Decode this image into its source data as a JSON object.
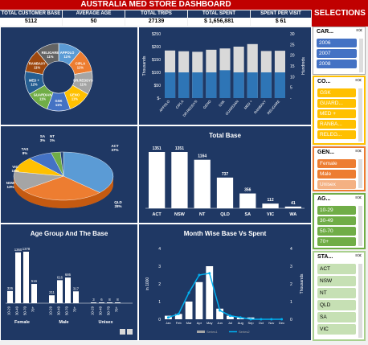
{
  "header": {
    "title": "AUSTRALIA MED STORE DASHBOARD",
    "selections": "SELECTIONS"
  },
  "kpis": [
    {
      "label": "TOTAL CUSTOMER BASE",
      "value": "5112"
    },
    {
      "label": "AVERAGE AGE",
      "value": "50"
    },
    {
      "label": "TOTAL TRIPS",
      "value": "27139"
    },
    {
      "label": "TOTAL SPENT",
      "value": "$       1,656,881"
    },
    {
      "label": "SPENT PER VISIT",
      "value": "$                61"
    }
  ],
  "colors": {
    "navy": "#1f3864",
    "red": "#c00000",
    "blue": "#2e75b6",
    "grey": "#d9d9d9"
  },
  "donut": {
    "slices": [
      {
        "label": "APPOLO",
        "pct": "11%",
        "color": "#5b9bd5"
      },
      {
        "label": "CIPLA",
        "pct": "11%",
        "color": "#ed7d31"
      },
      {
        "label": "DR.REDDYS",
        "pct": "11%",
        "color": "#a5a5a5"
      },
      {
        "label": "GENO",
        "pct": "11%",
        "color": "#ffc000"
      },
      {
        "label": "GSK",
        "pct": "11%",
        "color": "#4472c4"
      },
      {
        "label": "GUARDIAN",
        "pct": "11%",
        "color": "#70ad47"
      },
      {
        "label": "MED +",
        "pct": "12%",
        "color": "#255e91"
      },
      {
        "label": "RANBAXY",
        "pct": "11%",
        "color": "#9e480e"
      },
      {
        "label": "RELIGARE",
        "pct": "11%",
        "color": "#636363"
      }
    ]
  },
  "bar_top": {
    "y_left_unit": "Thousands",
    "y_right_unit": "Hundreds",
    "y_left_ticks": [
      "$250",
      "$200",
      "$150",
      "$100",
      "$50",
      "$-"
    ],
    "y_right_ticks": [
      "30",
      "25",
      "20",
      "15",
      "10",
      "5",
      "-"
    ],
    "categories": [
      "APPOLO",
      "CIPLA",
      "DR.REDDYS",
      "GENO",
      "GSK",
      "GUARDIAN",
      "MED +",
      "RANBAXY",
      "RELIGARE"
    ],
    "spent": [
      185,
      182,
      180,
      188,
      193,
      200,
      210,
      183,
      184
    ],
    "trips": [
      12,
      12,
      12,
      12,
      13,
      12,
      12,
      12,
      12
    ]
  },
  "pie3d": {
    "slices": [
      {
        "label": "TAS",
        "pct": "8%"
      },
      {
        "label": "VIC",
        "pct": "10%"
      },
      {
        "label": "SA",
        "pct": "3%"
      },
      {
        "label": "NT",
        "pct": "1%"
      },
      {
        "label": "QLD",
        "pct": "28%"
      },
      {
        "label": "NSW",
        "pct": "13%"
      },
      {
        "label": "ACT",
        "pct": "37%"
      }
    ]
  },
  "total_base": {
    "title": "Total Base",
    "categories": [
      "ACT",
      "NSW",
      "NT",
      "QLD",
      "SA",
      "VIC",
      "WA"
    ],
    "values": [
      1351,
      1351,
      1164,
      737,
      356,
      112,
      41
    ]
  },
  "age_group": {
    "title": "Age Group And The Base",
    "groups": [
      "Female",
      "Male",
      "Unisex"
    ],
    "bands": [
      "10-29",
      "30-49",
      "50-70",
      "70+"
    ],
    "values": [
      [
        326,
        1360,
        1378,
        516
      ],
      [
        211,
        616,
        686,
        317
      ],
      [
        3,
        6,
        8,
        8
      ]
    ]
  },
  "month": {
    "title": "Month Wise Base Vs Spent",
    "y_left_unit": "in 1000",
    "y_right_unit": "Thousands",
    "categories": [
      "Jan",
      "Feb",
      "Mar",
      "Apr",
      "May",
      "Jun",
      "Jul",
      "Aug",
      "Sep",
      "Oct",
      "Nov",
      "Dec"
    ],
    "base": [
      0.2,
      0.3,
      1.0,
      2.1,
      3.0,
      0.6,
      0.2,
      0.1,
      0.1,
      0.0,
      0.0,
      0.0
    ],
    "spent": [
      0.1,
      0.3,
      1.5,
      2.5,
      2.6,
      0.5,
      0.2,
      0.1,
      0.0,
      0.0,
      0.0,
      0.0
    ],
    "legend": [
      "Series1",
      "Series2"
    ]
  },
  "slicers": {
    "car": {
      "title": "CAR...",
      "items": [
        "2006",
        "2007",
        "2008"
      ]
    },
    "co": {
      "title": "CO...",
      "items": [
        "GSK",
        "GUARD...",
        "MED +",
        "RANBA...",
        "RELEG..."
      ]
    },
    "gen": {
      "title": "GEN...",
      "items": [
        "Female",
        "Male",
        "Unisex"
      ]
    },
    "ag": {
      "title": "AG...",
      "items": [
        "10-29",
        "30-49",
        "50-70",
        "70+"
      ]
    },
    "sta": {
      "title": "STA...",
      "items": [
        "ACT",
        "NSW",
        "NT",
        "QLD",
        "SA",
        "VIC"
      ]
    }
  }
}
